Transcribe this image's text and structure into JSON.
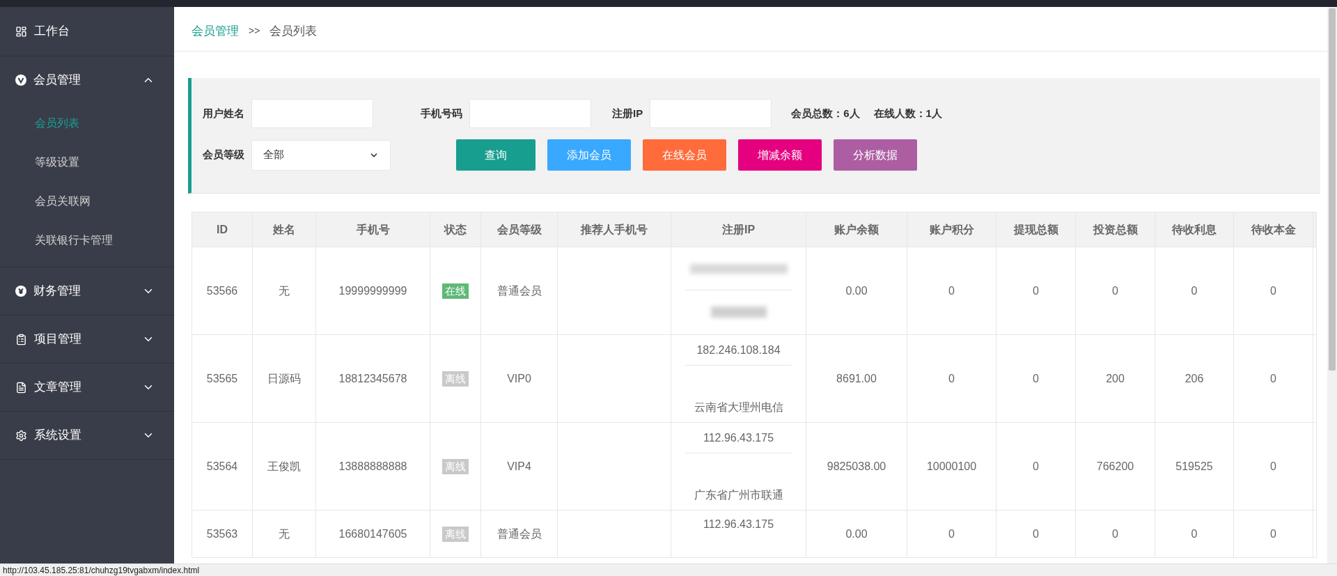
{
  "sidebar": {
    "items": [
      {
        "label": "工作台"
      },
      {
        "label": "会员管理",
        "expanded": true,
        "children": [
          {
            "label": "会员列表",
            "selected": true
          },
          {
            "label": "等级设置",
            "selected": false
          },
          {
            "label": "会员关联网",
            "selected": false
          },
          {
            "label": "关联银行卡管理",
            "selected": false
          }
        ]
      },
      {
        "label": "财务管理",
        "expanded": false
      },
      {
        "label": "项目管理",
        "expanded": false
      },
      {
        "label": "文章管理",
        "expanded": false
      },
      {
        "label": "系统设置",
        "expanded": false
      }
    ]
  },
  "breadcrumb": {
    "parent": "会员管理",
    "separator": ">>",
    "current": "会员列表"
  },
  "filters": {
    "fields": [
      {
        "label": "用户姓名"
      },
      {
        "label": "手机号码"
      },
      {
        "label": "注册IP"
      }
    ],
    "stats": [
      "会员总数：6人",
      "在线人数：1人"
    ],
    "select": {
      "label": "会员等级",
      "value": "全部"
    },
    "buttons": [
      {
        "label": "查询",
        "color": "#179e8f"
      },
      {
        "label": "添加会员",
        "color": "#39a8ff"
      },
      {
        "label": "在线会员",
        "color": "#ff6b3a"
      },
      {
        "label": "增减余额",
        "color": "#e5007f"
      },
      {
        "label": "分析数据",
        "color": "#ad5ea3"
      }
    ]
  },
  "table": {
    "columns": [
      "ID",
      "姓名",
      "手机号",
      "状态",
      "会员等级",
      "推荐人手机号",
      "注册IP",
      "账户余额",
      "账户积分",
      "提现总额",
      "投资总额",
      "待收利息",
      "待收本金"
    ],
    "rows": [
      {
        "id": "53566",
        "name": "无",
        "phone": "19999999999",
        "status": {
          "label": "在线",
          "online": true
        },
        "level": "普通会员",
        "ip": {
          "redacted": true
        },
        "amounts": [
          "0.00",
          "0",
          "0",
          "0",
          "0",
          "0"
        ]
      },
      {
        "id": "53565",
        "name": "日源码",
        "phone": "18812345678",
        "status": {
          "label": "离线",
          "online": false
        },
        "level": "VIP0",
        "ip": {
          "address": "182.246.108.184",
          "location": "云南省大理州电信"
        },
        "amounts": [
          "8691.00",
          "0",
          "0",
          "200",
          "206",
          "0"
        ]
      },
      {
        "id": "53564",
        "name": "王俊凯",
        "phone": "13888888888",
        "status": {
          "label": "离线",
          "online": false
        },
        "level": "VIP4",
        "ip": {
          "address": "112.96.43.175",
          "location": "广东省广州市联通"
        },
        "amounts": [
          "9825038.00",
          "10000100",
          "0",
          "766200",
          "519525",
          "0"
        ]
      },
      {
        "id": "53563",
        "name": "无",
        "phone": "16680147605",
        "status": {
          "label": "离线",
          "online": false
        },
        "level": "普通会员",
        "ip": {
          "address": "112.96.43.175"
        },
        "amounts": [
          "0.00",
          "0",
          "0",
          "0",
          "0",
          "0"
        ]
      }
    ]
  },
  "status_bar": {
    "url": "http://103.45.185.25:81/chuhzg19tvgabxm/index.html"
  }
}
